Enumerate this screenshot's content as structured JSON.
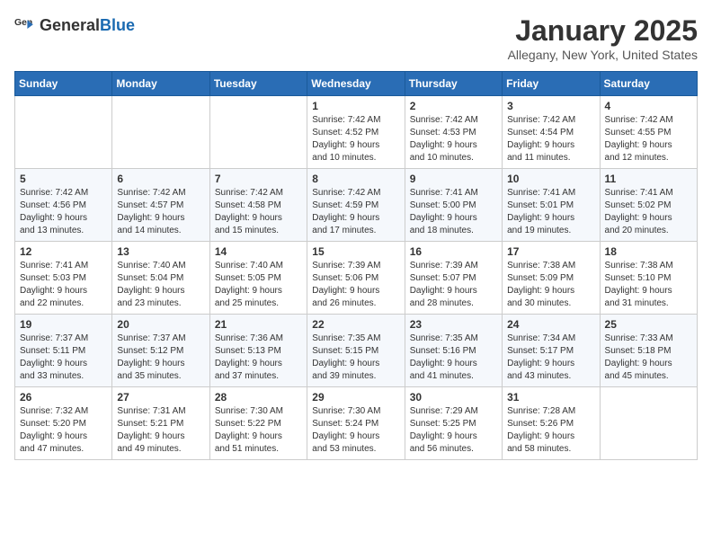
{
  "header": {
    "logo_general": "General",
    "logo_blue": "Blue",
    "title": "January 2025",
    "location": "Allegany, New York, United States"
  },
  "calendar": {
    "days_of_week": [
      "Sunday",
      "Monday",
      "Tuesday",
      "Wednesday",
      "Thursday",
      "Friday",
      "Saturday"
    ],
    "weeks": [
      [
        {
          "day": "",
          "info": ""
        },
        {
          "day": "",
          "info": ""
        },
        {
          "day": "",
          "info": ""
        },
        {
          "day": "1",
          "info": "Sunrise: 7:42 AM\nSunset: 4:52 PM\nDaylight: 9 hours\nand 10 minutes."
        },
        {
          "day": "2",
          "info": "Sunrise: 7:42 AM\nSunset: 4:53 PM\nDaylight: 9 hours\nand 10 minutes."
        },
        {
          "day": "3",
          "info": "Sunrise: 7:42 AM\nSunset: 4:54 PM\nDaylight: 9 hours\nand 11 minutes."
        },
        {
          "day": "4",
          "info": "Sunrise: 7:42 AM\nSunset: 4:55 PM\nDaylight: 9 hours\nand 12 minutes."
        }
      ],
      [
        {
          "day": "5",
          "info": "Sunrise: 7:42 AM\nSunset: 4:56 PM\nDaylight: 9 hours\nand 13 minutes."
        },
        {
          "day": "6",
          "info": "Sunrise: 7:42 AM\nSunset: 4:57 PM\nDaylight: 9 hours\nand 14 minutes."
        },
        {
          "day": "7",
          "info": "Sunrise: 7:42 AM\nSunset: 4:58 PM\nDaylight: 9 hours\nand 15 minutes."
        },
        {
          "day": "8",
          "info": "Sunrise: 7:42 AM\nSunset: 4:59 PM\nDaylight: 9 hours\nand 17 minutes."
        },
        {
          "day": "9",
          "info": "Sunrise: 7:41 AM\nSunset: 5:00 PM\nDaylight: 9 hours\nand 18 minutes."
        },
        {
          "day": "10",
          "info": "Sunrise: 7:41 AM\nSunset: 5:01 PM\nDaylight: 9 hours\nand 19 minutes."
        },
        {
          "day": "11",
          "info": "Sunrise: 7:41 AM\nSunset: 5:02 PM\nDaylight: 9 hours\nand 20 minutes."
        }
      ],
      [
        {
          "day": "12",
          "info": "Sunrise: 7:41 AM\nSunset: 5:03 PM\nDaylight: 9 hours\nand 22 minutes."
        },
        {
          "day": "13",
          "info": "Sunrise: 7:40 AM\nSunset: 5:04 PM\nDaylight: 9 hours\nand 23 minutes."
        },
        {
          "day": "14",
          "info": "Sunrise: 7:40 AM\nSunset: 5:05 PM\nDaylight: 9 hours\nand 25 minutes."
        },
        {
          "day": "15",
          "info": "Sunrise: 7:39 AM\nSunset: 5:06 PM\nDaylight: 9 hours\nand 26 minutes."
        },
        {
          "day": "16",
          "info": "Sunrise: 7:39 AM\nSunset: 5:07 PM\nDaylight: 9 hours\nand 28 minutes."
        },
        {
          "day": "17",
          "info": "Sunrise: 7:38 AM\nSunset: 5:09 PM\nDaylight: 9 hours\nand 30 minutes."
        },
        {
          "day": "18",
          "info": "Sunrise: 7:38 AM\nSunset: 5:10 PM\nDaylight: 9 hours\nand 31 minutes."
        }
      ],
      [
        {
          "day": "19",
          "info": "Sunrise: 7:37 AM\nSunset: 5:11 PM\nDaylight: 9 hours\nand 33 minutes."
        },
        {
          "day": "20",
          "info": "Sunrise: 7:37 AM\nSunset: 5:12 PM\nDaylight: 9 hours\nand 35 minutes."
        },
        {
          "day": "21",
          "info": "Sunrise: 7:36 AM\nSunset: 5:13 PM\nDaylight: 9 hours\nand 37 minutes."
        },
        {
          "day": "22",
          "info": "Sunrise: 7:35 AM\nSunset: 5:15 PM\nDaylight: 9 hours\nand 39 minutes."
        },
        {
          "day": "23",
          "info": "Sunrise: 7:35 AM\nSunset: 5:16 PM\nDaylight: 9 hours\nand 41 minutes."
        },
        {
          "day": "24",
          "info": "Sunrise: 7:34 AM\nSunset: 5:17 PM\nDaylight: 9 hours\nand 43 minutes."
        },
        {
          "day": "25",
          "info": "Sunrise: 7:33 AM\nSunset: 5:18 PM\nDaylight: 9 hours\nand 45 minutes."
        }
      ],
      [
        {
          "day": "26",
          "info": "Sunrise: 7:32 AM\nSunset: 5:20 PM\nDaylight: 9 hours\nand 47 minutes."
        },
        {
          "day": "27",
          "info": "Sunrise: 7:31 AM\nSunset: 5:21 PM\nDaylight: 9 hours\nand 49 minutes."
        },
        {
          "day": "28",
          "info": "Sunrise: 7:30 AM\nSunset: 5:22 PM\nDaylight: 9 hours\nand 51 minutes."
        },
        {
          "day": "29",
          "info": "Sunrise: 7:30 AM\nSunset: 5:24 PM\nDaylight: 9 hours\nand 53 minutes."
        },
        {
          "day": "30",
          "info": "Sunrise: 7:29 AM\nSunset: 5:25 PM\nDaylight: 9 hours\nand 56 minutes."
        },
        {
          "day": "31",
          "info": "Sunrise: 7:28 AM\nSunset: 5:26 PM\nDaylight: 9 hours\nand 58 minutes."
        },
        {
          "day": "",
          "info": ""
        }
      ]
    ]
  }
}
